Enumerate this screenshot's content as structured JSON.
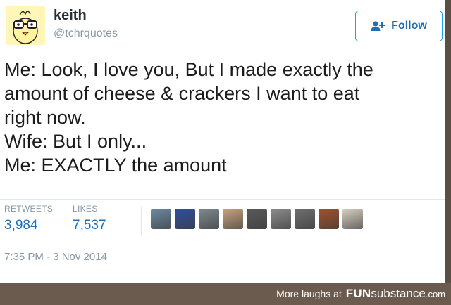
{
  "user": {
    "name": "keith",
    "handle": "@tchrquotes",
    "avatar_icon": "cartoon-chick-with-glasses"
  },
  "follow_button": {
    "label": "Follow",
    "icon": "add-user-icon"
  },
  "tweet": {
    "lines": [
      "Me: Look, I love you, But I made exactly the",
      "amount of cheese & crackers I want to eat",
      "right now.",
      "Wife: But I only...",
      "Me: EXACTLY the amount"
    ]
  },
  "stats": {
    "retweets_label": "RETWEETS",
    "retweets_count": "3,984",
    "likes_label": "LIKES",
    "likes_count": "7,537"
  },
  "likers": [
    {
      "name": "liker-avatar-1",
      "color": "#6c8aa3"
    },
    {
      "name": "liker-avatar-2",
      "color": "#2f4f9e"
    },
    {
      "name": "liker-avatar-3",
      "color": "#7d8a8f"
    },
    {
      "name": "liker-avatar-4",
      "color": "#c9a47e"
    },
    {
      "name": "liker-avatar-5",
      "color": "#5a5a5a"
    },
    {
      "name": "liker-avatar-6",
      "color": "#8c8c8c"
    },
    {
      "name": "liker-avatar-7",
      "color": "#6f6f6f"
    },
    {
      "name": "liker-avatar-8",
      "color": "#a0522d"
    },
    {
      "name": "liker-avatar-9",
      "color": "#d8cfc0"
    }
  ],
  "timestamp": "7:35 PM - 3 Nov 2014",
  "footer": {
    "prefix": "More laughs at",
    "brand_part1": "FUN",
    "brand_part2": "substance",
    "brand_part3": ".com"
  },
  "colors": {
    "accent": "#1d6fb8",
    "muted": "#8899a6",
    "footer_bg": "#6b5a4e"
  }
}
